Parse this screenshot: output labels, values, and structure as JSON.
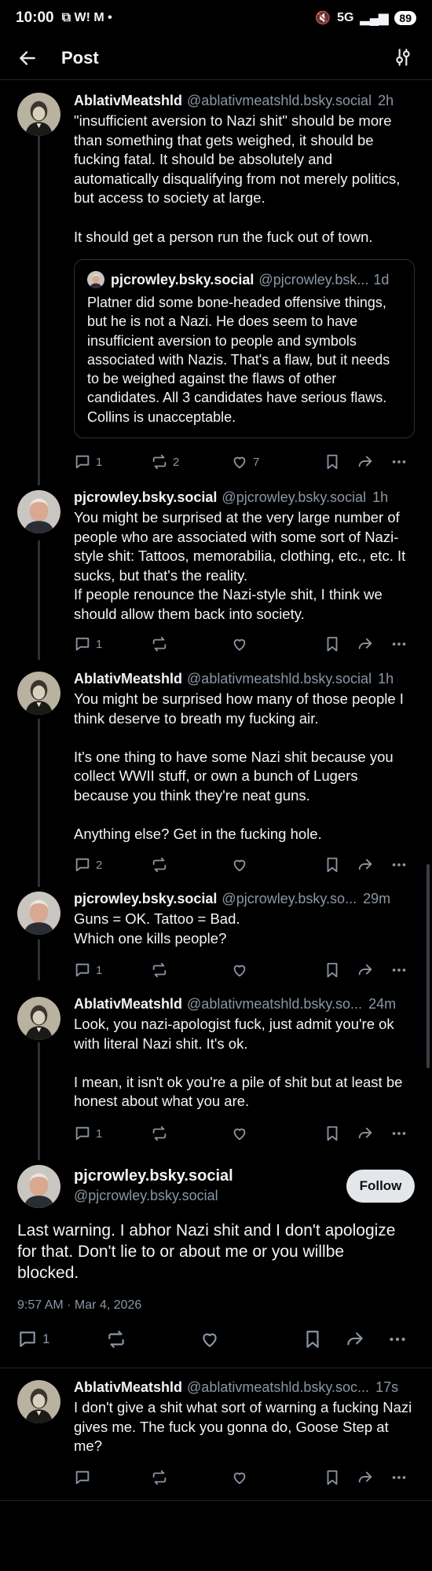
{
  "status_bar": {
    "time": "10:00",
    "notif_icons": "⧉ W! M •",
    "network": "5G",
    "battery": "89"
  },
  "header": {
    "title": "Post"
  },
  "posts": [
    {
      "name": "AblativMeatshld",
      "handle": "@ablativmeatshld.bsky.social",
      "time": "2h",
      "text": "\"insufficient aversion to Nazi shit\" should be more than something that gets weighed, it should be fucking fatal. It should be absolutely and automatically disqualifying from not merely politics, but access to society at large.\n\nIt should get a person run the fuck out of town.",
      "quote": {
        "name": "pjcrowley.bsky.social",
        "handle": "@pjcrowley.bsk...",
        "time": "1d",
        "text": "Platner did some bone-headed offensive things, but he is not a Nazi. He does seem to have insufficient aversion to people and symbols associated with Nazis. That's a flaw, but it needs to be weighed against the flaws of other candidates. All 3 candidates have serious flaws. Collins is unacceptable."
      },
      "replies": "1",
      "reposts": "2",
      "likes": "7"
    },
    {
      "name": "pjcrowley.bsky.social",
      "handle": "@pjcrowley.bsky.social",
      "time": "1h",
      "text": "You might be surprised at the very large number of people who are associated with some sort of Nazi-style shit: Tattoos, memorabilia, clothing, etc., etc.  It sucks, but that's the reality.\nIf people renounce the Nazi-style shit, I think we should allow them back into society.",
      "replies": "1",
      "reposts": "",
      "likes": ""
    },
    {
      "name": "AblativMeatshld",
      "handle": "@ablativmeatshld.bsky.social",
      "time": "1h",
      "text": "You might be surprised how many of those people I think deserve to breath my fucking air.\n\nIt's one thing to have some Nazi shit because you collect WWII stuff, or own a bunch of Lugers because you think they're neat guns.\n\nAnything else? Get in the fucking hole.",
      "replies": "2",
      "reposts": "",
      "likes": ""
    },
    {
      "name": "pjcrowley.bsky.social",
      "handle": "@pjcrowley.bsky.so...",
      "time": "29m",
      "text": "Guns = OK. Tattoo = Bad.\nWhich one kills people?",
      "replies": "1",
      "reposts": "",
      "likes": ""
    },
    {
      "name": "AblativMeatshld",
      "handle": "@ablativmeatshld.bsky.so...",
      "time": "24m",
      "text": "Look, you nazi-apologist fuck, just admit you're ok with literal Nazi shit. It's ok.\n\nI mean, it isn't ok you're a pile of shit but at least be honest about what you are.",
      "replies": "1",
      "reposts": "",
      "likes": ""
    }
  ],
  "focus": {
    "name": "pjcrowley.bsky.social",
    "handle": "@pjcrowley.bsky.social",
    "follow_label": "Follow",
    "text": "Last warning. I abhor Nazi shit and I don't apologize for that. Don't lie to or about me or you willbe blocked.",
    "date": "9:57 AM · Mar 4, 2026",
    "replies": "1"
  },
  "last_reply": {
    "name": "AblativMeatshld",
    "handle": "@ablativmeatshld.bsky.soc...",
    "time": "17s",
    "text": "I don't give a shit what sort of warning a fucking Nazi gives me. The fuck you gonna do, Goose Step at me?"
  }
}
